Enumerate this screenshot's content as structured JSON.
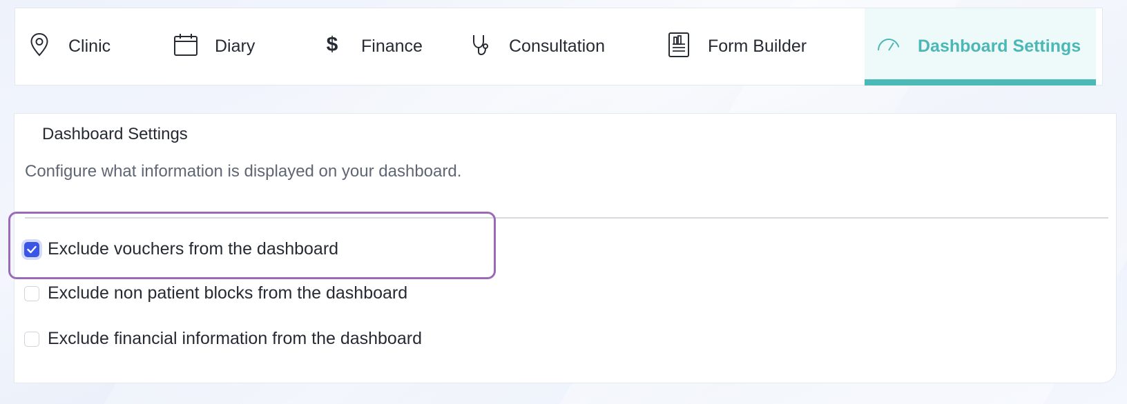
{
  "tabs": [
    {
      "label": "Clinic",
      "icon": "location-pin-icon"
    },
    {
      "label": "Diary",
      "icon": "calendar-icon"
    },
    {
      "label": "Finance",
      "icon": "dollar-icon"
    },
    {
      "label": "Consultation",
      "icon": "stethoscope-icon"
    },
    {
      "label": "Form Builder",
      "icon": "form-report-icon"
    },
    {
      "label": "Dashboard Settings",
      "icon": "speedometer-icon",
      "active": true
    }
  ],
  "settings": {
    "title": "Dashboard Settings",
    "subtitle": "Configure what information is displayed on your dashboard.",
    "options": [
      {
        "label": "Exclude vouchers from the dashboard",
        "checked": true
      },
      {
        "label": "Exclude non patient blocks from the dashboard",
        "checked": false
      },
      {
        "label": "Exclude financial information from the dashboard",
        "checked": false
      }
    ]
  },
  "colors": {
    "accent_teal": "#4bbab6",
    "checkbox_blue": "#3b55e6",
    "highlight_purple": "#9a6ab8"
  }
}
